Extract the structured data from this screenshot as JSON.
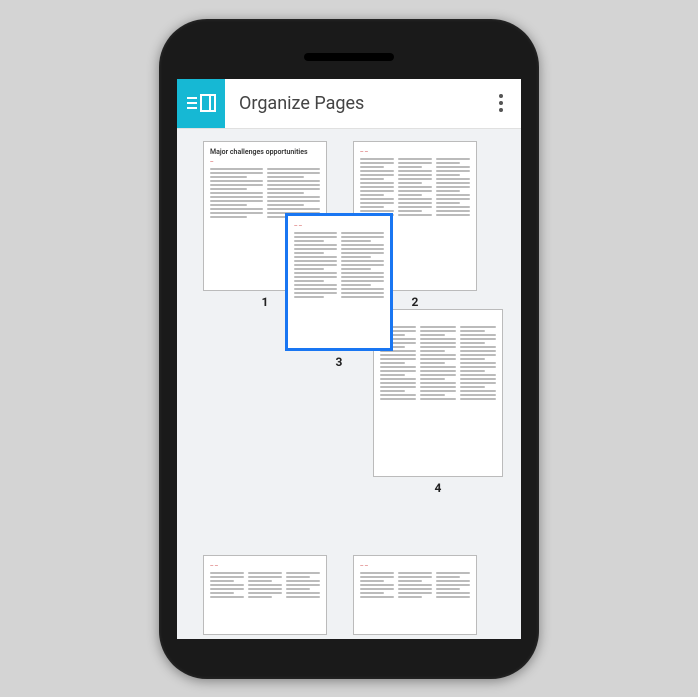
{
  "appbar": {
    "title": "Organize Pages"
  },
  "pages": {
    "p1": {
      "label": "1",
      "title": "Major challenges opportunities"
    },
    "p2": {
      "label": "2"
    },
    "p3": {
      "label": "3"
    },
    "p4": {
      "label": "4"
    }
  },
  "selected_page": "3"
}
